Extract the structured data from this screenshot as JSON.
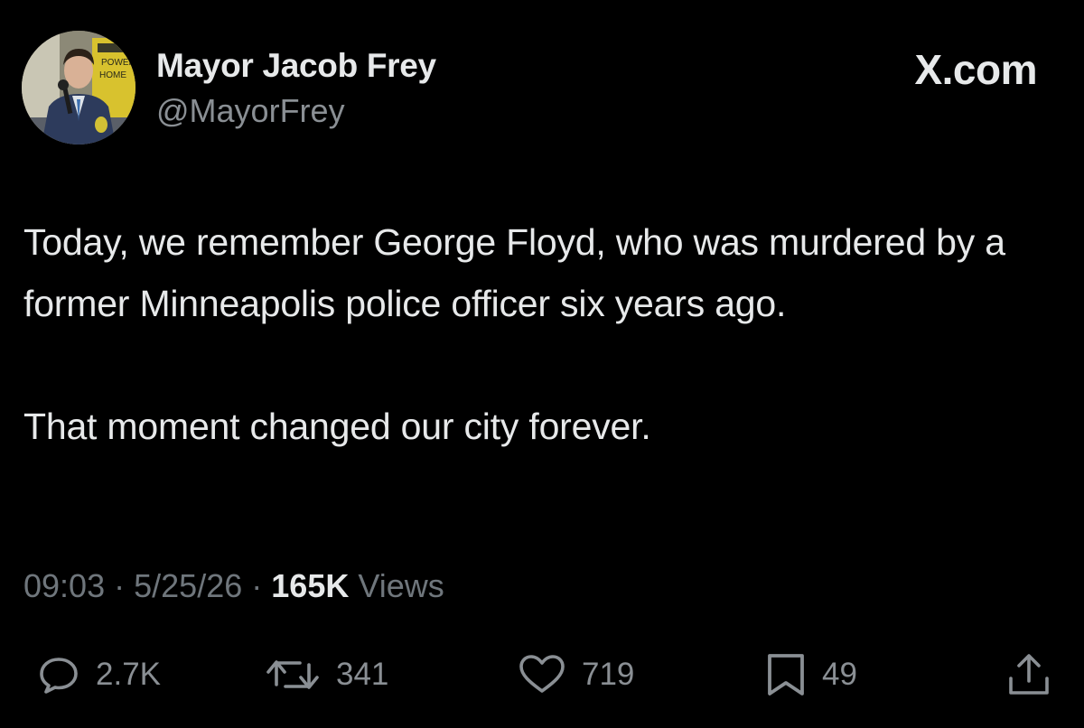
{
  "author": {
    "display_name": "Mayor Jacob Frey",
    "handle": "@MayorFrey"
  },
  "avatar_sign_text": [
    "POWER",
    "HOME"
  ],
  "brand": "X.com",
  "tweet": {
    "paragraphs": [
      "Today, we remember George Floyd, who was murdered by a former Minneapolis police officer six years ago.",
      "That moment changed our city forever."
    ]
  },
  "meta": {
    "time": "09:03",
    "separator": "·",
    "date": "5/25/26",
    "views_count": "165K",
    "views_label": "Views"
  },
  "actions": {
    "replies": "2.7K",
    "reposts": "341",
    "likes": "719",
    "bookmarks": "49"
  },
  "icons": {
    "reply": "speech-bubble-icon",
    "repost": "repost-arrows-icon",
    "like": "heart-icon",
    "bookmark": "bookmark-icon",
    "share": "share-upload-icon"
  },
  "colors": {
    "background": "#000000",
    "primary_text": "#e7e9ea",
    "secondary_text": "#8a8f94",
    "meta_text": "#6f767c"
  }
}
